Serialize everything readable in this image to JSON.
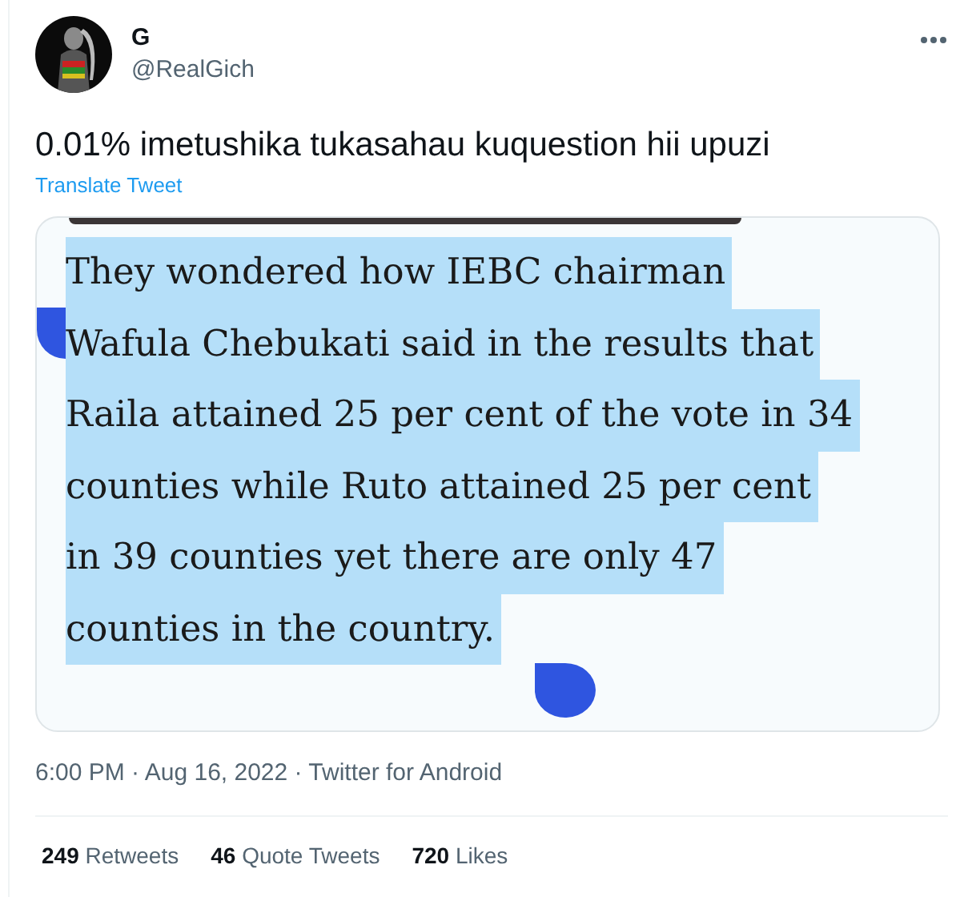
{
  "author": {
    "name": "G",
    "handle": "@RealGich"
  },
  "tweet": {
    "text": "0.01% imetushika tukasahau kuquestion hii upuzi",
    "translate_link": "Translate Tweet"
  },
  "media": {
    "lines": [
      {
        "text": "They wondered how IEBC chairman",
        "selected": true
      },
      {
        "text": "Wafula Chebukati said in the results that",
        "selected": true
      },
      {
        "text": "Raila attained 25 per cent of the vote in 34",
        "selected": true
      },
      {
        "text": "counties while Ruto attained 25 per cent",
        "selected": true
      },
      {
        "text": "in 39 counties yet there are only 47",
        "selected": true
      },
      {
        "text": "counties in the country.",
        "selected": true
      }
    ]
  },
  "timestamp": "6:00 PM · Aug 16, 2022 · Twitter for Android",
  "stats": [
    {
      "count": "249",
      "label": "Retweets"
    },
    {
      "count": "46",
      "label": "Quote Tweets"
    },
    {
      "count": "720",
      "label": "Likes"
    }
  ]
}
